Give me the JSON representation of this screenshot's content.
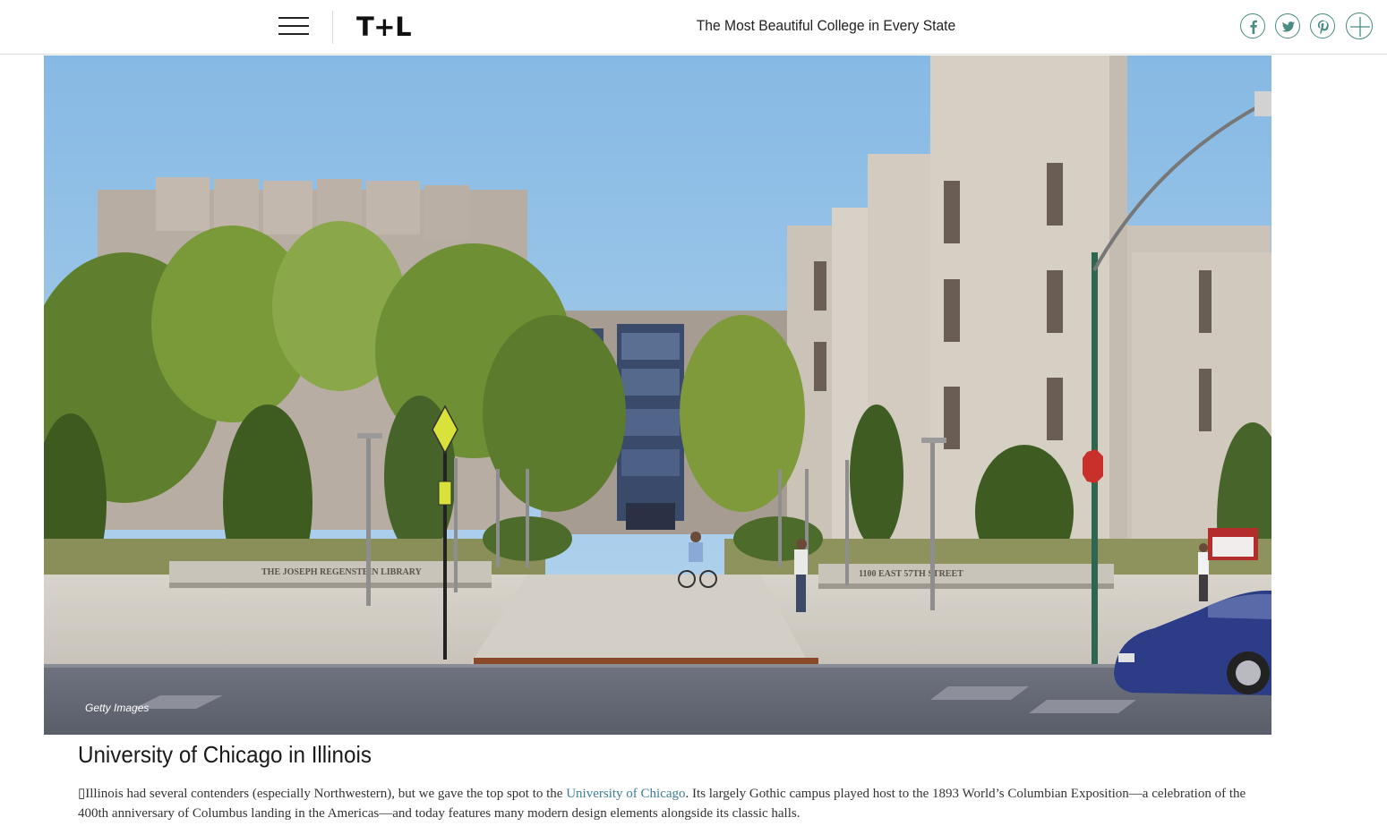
{
  "header": {
    "logo": "T+L",
    "page_title": "The Most Beautiful College in Every State",
    "menu_icon": "hamburger-menu-icon",
    "share_icons": [
      "facebook-icon",
      "twitter-icon",
      "pinterest-icon",
      "plus-icon"
    ],
    "accent_color": "#4a8c82"
  },
  "hero": {
    "credit": "Getty Images",
    "signs": {
      "library": "THE JOSEPH REGENSTEIN LIBRARY",
      "street": "1100 EAST 57TH STREET"
    }
  },
  "article": {
    "heading": "University of Chicago in Illinois",
    "paragraph": {
      "glyph": "▯",
      "before": "Illinois had several contenders (especially Northwestern), but we gave the top spot to the ",
      "link": "University of Chicago",
      "after": ". Its largely Gothic campus played host to the 1893 World’s Columbian Exposition—a celebration of the 400th anniversary of Columbus landing in the Americas—and today features many modern design elements alongside its classic halls."
    },
    "link_color": "#3d7d95"
  }
}
